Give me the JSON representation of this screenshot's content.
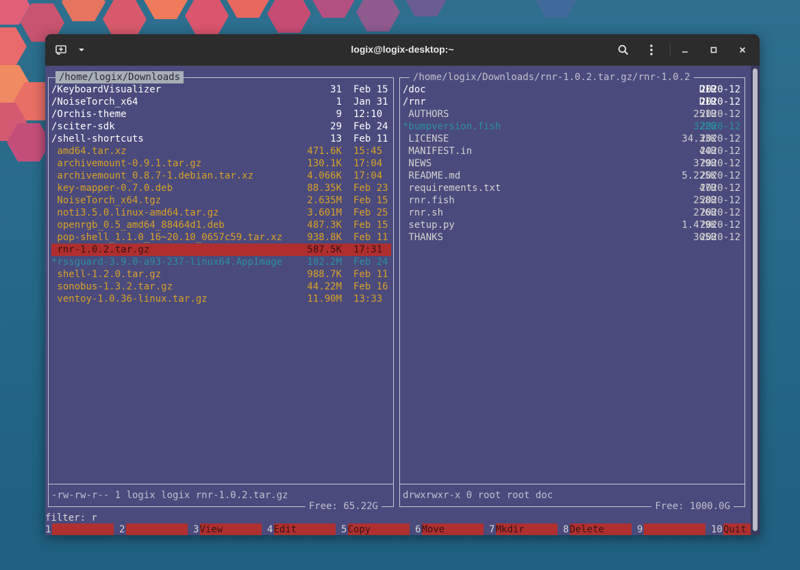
{
  "window": {
    "title": "logix@logix-desktop:~",
    "new_tab_icon": "new-tab-icon",
    "menu_icon": "chevron-down-icon",
    "search_icon": "search-icon",
    "more_icon": "kebab-menu-icon",
    "minimize": "–",
    "maximize": "▫",
    "close": "✕"
  },
  "left_panel": {
    "path": "/home/logix/Downloads",
    "files": [
      {
        "name": "/KeyboardVisualizer",
        "size": "31",
        "time": "Feb 15",
        "kind": "dir"
      },
      {
        "name": "/NoiseTorch_x64",
        "size": "1",
        "time": "Jan 31",
        "kind": "dir"
      },
      {
        "name": "/Orchis-theme",
        "size": "9",
        "time": "12:10",
        "kind": "dir"
      },
      {
        "name": "/sciter-sdk",
        "size": "29",
        "time": "Feb 24",
        "kind": "dir"
      },
      {
        "name": "/shell-shortcuts",
        "size": "13",
        "time": "Feb 11",
        "kind": "dir"
      },
      {
        "name": " amd64.tar.xz",
        "size": "471.6K",
        "time": "15:45",
        "kind": "archive"
      },
      {
        "name": " archivemount-0.9.1.tar.gz",
        "size": "130.1K",
        "time": "17:04",
        "kind": "archive"
      },
      {
        "name": " archivemount_0.8.7-1.debian.tar.xz",
        "size": "4.066K",
        "time": "17:04",
        "kind": "archive"
      },
      {
        "name": " key-mapper-0.7.0.deb",
        "size": "88.35K",
        "time": "Feb 23",
        "kind": "archive"
      },
      {
        "name": " NoiseTorch_x64.tgz",
        "size": "2.635M",
        "time": "Feb 15",
        "kind": "archive"
      },
      {
        "name": " noti3.5.0.linux-amd64.tar.gz",
        "size": "3.601M",
        "time": "Feb 25",
        "kind": "archive"
      },
      {
        "name": " openrgb_0.5_amd64_88464d1.deb",
        "size": "487.3K",
        "time": "Feb 15",
        "kind": "archive"
      },
      {
        "name": " pop-shell_1.1.0_16~20.10_0657c59.tar.xz",
        "size": "938.8K",
        "time": "Feb 11",
        "kind": "archive"
      },
      {
        "name": " rnr-1.0.2.tar.gz",
        "size": "587.5K",
        "time": "17:31",
        "kind": "selected"
      },
      {
        "name": "*rssguard-3.9.0-a93-237-linux64.AppImage",
        "size": "102.2M",
        "time": "Feb 24",
        "kind": "exec"
      },
      {
        "name": " shell-1.2.0.tar.gz",
        "size": "988.7K",
        "time": "Feb 11",
        "kind": "archive"
      },
      {
        "name": " sonobus-1.3.2.tar.gz",
        "size": "44.22M",
        "time": "Feb 16",
        "kind": "archive"
      },
      {
        "name": " ventoy-1.0.36-linux.tar.gz",
        "size": "11.90M",
        "time": "13:33",
        "kind": "archive"
      }
    ],
    "info": "-rw-rw-r-- 1 logix logix rnr-1.0.2.tar.gz",
    "free": "Free: 65.22G"
  },
  "right_panel": {
    "path": "/home/logix/Downloads/rnr-1.0.2.tar.gz/rnr-1.0.2",
    "files": [
      {
        "name": "/doc",
        "size": "DIR",
        "time": "2020-12",
        "kind": "dir"
      },
      {
        "name": "/rnr",
        "size": "DIR",
        "time": "2020-12",
        "kind": "dir"
      },
      {
        "name": " AUTHORS",
        "size": "251B",
        "time": "2020-12",
        "kind": "plain"
      },
      {
        "name": "*bumpversion.fish",
        "size": "322B",
        "time": "2020-12",
        "kind": "exec"
      },
      {
        "name": " LICENSE",
        "size": "34.33K",
        "time": "2020-12",
        "kind": "plain"
      },
      {
        "name": " MANIFEST.in",
        "size": "44B",
        "time": "2020-12",
        "kind": "plain"
      },
      {
        "name": " NEWS",
        "size": "379B",
        "time": "2020-12",
        "kind": "plain"
      },
      {
        "name": " README.md",
        "size": "5.225K",
        "time": "2020-12",
        "kind": "plain"
      },
      {
        "name": " requirements.txt",
        "size": "47B",
        "time": "2020-12",
        "kind": "plain"
      },
      {
        "name": " rnr.fish",
        "size": "258B",
        "time": "2020-12",
        "kind": "plain"
      },
      {
        "name": " rnr.sh",
        "size": "276B",
        "time": "2020-12",
        "kind": "plain"
      },
      {
        "name": " setup.py",
        "size": "1.479K",
        "time": "2020-12",
        "kind": "plain"
      },
      {
        "name": " THANKS",
        "size": "305B",
        "time": "2020-12",
        "kind": "plain"
      }
    ],
    "info": "drwxrwxr-x 0 root root doc",
    "free": "Free: 1000.0G"
  },
  "filter": "filter: r",
  "fkeys": [
    {
      "num": "1",
      "label": ""
    },
    {
      "num": "2",
      "label": ""
    },
    {
      "num": "3",
      "label": "View"
    },
    {
      "num": "4",
      "label": "Edit"
    },
    {
      "num": "5",
      "label": "Copy"
    },
    {
      "num": "6",
      "label": "Move"
    },
    {
      "num": "7",
      "label": "Mkdir"
    },
    {
      "num": "8",
      "label": "Delete"
    },
    {
      "num": "9",
      "label": ""
    },
    {
      "num": "10",
      "label": "Quit"
    }
  ],
  "colors": {
    "terminal_bg": "#4a4a7c",
    "archive": "#dba127",
    "executable": "#2b8fa1",
    "selection": "#b12e2e",
    "fkey_bg": "#b03030"
  }
}
